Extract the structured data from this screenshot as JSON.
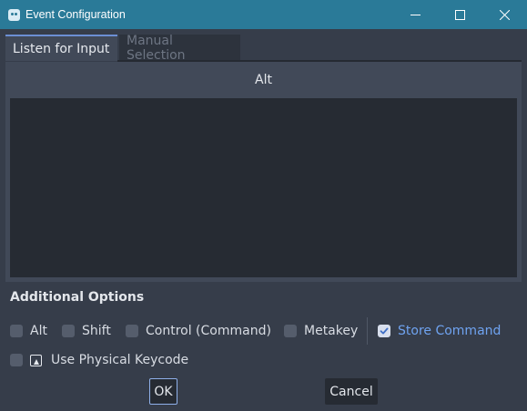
{
  "window": {
    "title": "Event Configuration",
    "icon": "godot-icon",
    "controls": [
      "minimize-icon",
      "maximize-icon",
      "close-icon"
    ]
  },
  "tabs": [
    {
      "label": "Listen for Input",
      "active": true
    },
    {
      "label": "Manual Selection",
      "active": false
    }
  ],
  "listen": {
    "current_event": "Alt"
  },
  "options": {
    "title": "Additional Options",
    "modifiers": [
      {
        "label": "Alt",
        "checked": false
      },
      {
        "label": "Shift",
        "checked": false
      },
      {
        "label": "Control (Command)",
        "checked": false
      },
      {
        "label": "Metakey",
        "checked": false
      },
      {
        "label": "Store Command",
        "checked": true
      }
    ],
    "physical": {
      "label": "Use Physical Keycode",
      "checked": false,
      "icon": "keyboard-physical-icon"
    }
  },
  "buttons": {
    "ok": "OK",
    "cancel": "Cancel"
  },
  "colors": {
    "titlebar": "#2a7a98",
    "background": "#363d4a",
    "accent": "#6fa3f0"
  }
}
